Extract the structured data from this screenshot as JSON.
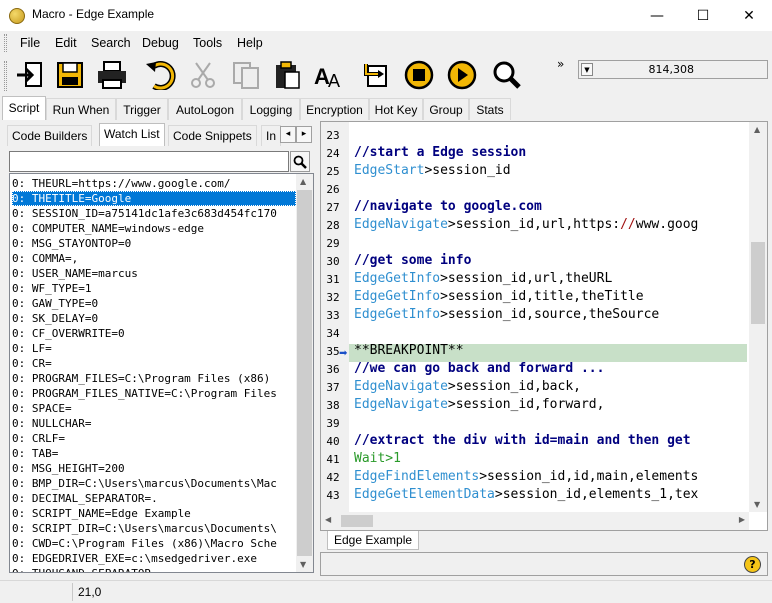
{
  "window": {
    "title": "Macro - Edge Example",
    "min": "—",
    "max": "☐",
    "close": "✕"
  },
  "menu": [
    "File",
    "Edit",
    "Search",
    "Debug",
    "Tools",
    "Help"
  ],
  "toolbar": {
    "overflow": "»",
    "coord": "814,308"
  },
  "main_tabs": [
    "Script",
    "Run When",
    "Trigger",
    "AutoLogon",
    "Logging",
    "Encryption",
    "Hot Key",
    "Group",
    "Stats"
  ],
  "sub_tabs": [
    "Code Builders",
    "Watch List",
    "Code Snippets",
    "In"
  ],
  "sub_tab_arrows": [
    "◂",
    "▸"
  ],
  "search": {
    "value": "",
    "placeholder": ""
  },
  "watch_list": [
    "0: THEURL=https://www.google.com/",
    "0: THETITLE=Google",
    "0: SESSION_ID=a75141dc1afe3c683d454fc170",
    "0: COMPUTER_NAME=windows-edge",
    "0: MSG_STAYONTOP=0",
    "0: COMMA=,",
    "0: USER_NAME=marcus",
    "0: WF_TYPE=1",
    "0: GAW_TYPE=0",
    "0: SK_DELAY=0",
    "0: CF_OVERWRITE=0",
    "0: LF=",
    "0: CR=",
    "0: PROGRAM_FILES=C:\\Program Files (x86)",
    "0: PROGRAM_FILES_NATIVE=C:\\Program Files",
    "0: SPACE=",
    "0: NULLCHAR=",
    "0: CRLF=",
    "0: TAB=",
    "0: MSG_HEIGHT=200",
    "0: BMP_DIR=C:\\Users\\marcus\\Documents\\Mac",
    "0: DECIMAL_SEPARATOR=.",
    "0: SCRIPT_NAME=Edge Example",
    "0: SCRIPT_DIR=C:\\Users\\marcus\\Documents\\",
    "0: CWD=C:\\Program Files (x86)\\Macro Sche",
    "0: EDGEDRIVER_EXE=c:\\msedgedriver.exe",
    "0: THOUSAND_SEPARATOR"
  ],
  "editor": {
    "lines": [
      {
        "n": "23",
        "parts": []
      },
      {
        "n": "24",
        "parts": [
          {
            "t": "//start a Edge session",
            "c": "cmt"
          }
        ]
      },
      {
        "n": "25",
        "parts": [
          {
            "t": "EdgeStart",
            "c": "fn"
          },
          {
            "t": ">session_id",
            "c": "plain"
          }
        ]
      },
      {
        "n": "26",
        "parts": []
      },
      {
        "n": "27",
        "parts": [
          {
            "t": "//navigate to google.com",
            "c": "cmt"
          }
        ]
      },
      {
        "n": "28",
        "parts": [
          {
            "t": "EdgeNavigate",
            "c": "fn"
          },
          {
            "t": ">session_id,url,https:",
            "c": "plain"
          },
          {
            "t": "//",
            "c": "strred"
          },
          {
            "t": "www.goog",
            "c": "plain"
          }
        ]
      },
      {
        "n": "29",
        "parts": []
      },
      {
        "n": "30",
        "parts": [
          {
            "t": "//get some info",
            "c": "cmt"
          }
        ]
      },
      {
        "n": "31",
        "parts": [
          {
            "t": "EdgeGetInfo",
            "c": "fn"
          },
          {
            "t": ">session_id,url,theURL",
            "c": "plain"
          }
        ]
      },
      {
        "n": "32",
        "parts": [
          {
            "t": "EdgeGetInfo",
            "c": "fn"
          },
          {
            "t": ">session_id,title,theTitle",
            "c": "plain"
          }
        ]
      },
      {
        "n": "33",
        "parts": [
          {
            "t": "EdgeGetInfo",
            "c": "fn"
          },
          {
            "t": ">session_id,source,theSource",
            "c": "plain"
          }
        ]
      },
      {
        "n": "34",
        "parts": []
      },
      {
        "n": "35",
        "parts": [
          {
            "t": "**BREAKPOINT**",
            "c": "plain"
          }
        ]
      },
      {
        "n": "36",
        "parts": [
          {
            "t": "//we can go back and forward ...",
            "c": "cmt"
          }
        ]
      },
      {
        "n": "37",
        "parts": [
          {
            "t": "EdgeNavigate",
            "c": "fn"
          },
          {
            "t": ">session_id,back,",
            "c": "plain"
          }
        ]
      },
      {
        "n": "38",
        "parts": [
          {
            "t": "EdgeNavigate",
            "c": "fn"
          },
          {
            "t": ">session_id,forward,",
            "c": "plain"
          }
        ]
      },
      {
        "n": "39",
        "parts": []
      },
      {
        "n": "40",
        "parts": [
          {
            "t": "//extract the div with id=main and then get",
            "c": "cmt"
          }
        ]
      },
      {
        "n": "41",
        "parts": [
          {
            "t": "Wait>1",
            "c": "wait"
          }
        ]
      },
      {
        "n": "42",
        "parts": [
          {
            "t": "EdgeFindElements",
            "c": "fn"
          },
          {
            "t": ">session_id,id,main,elements",
            "c": "plain"
          }
        ]
      },
      {
        "n": "43",
        "parts": [
          {
            "t": "EdgeGetElementData",
            "c": "fn"
          },
          {
            "t": ">session_id,elements_1,tex",
            "c": "plain"
          }
        ]
      }
    ],
    "file_tab": "Edge Example"
  },
  "help": "?",
  "status": {
    "position": "21,0"
  }
}
